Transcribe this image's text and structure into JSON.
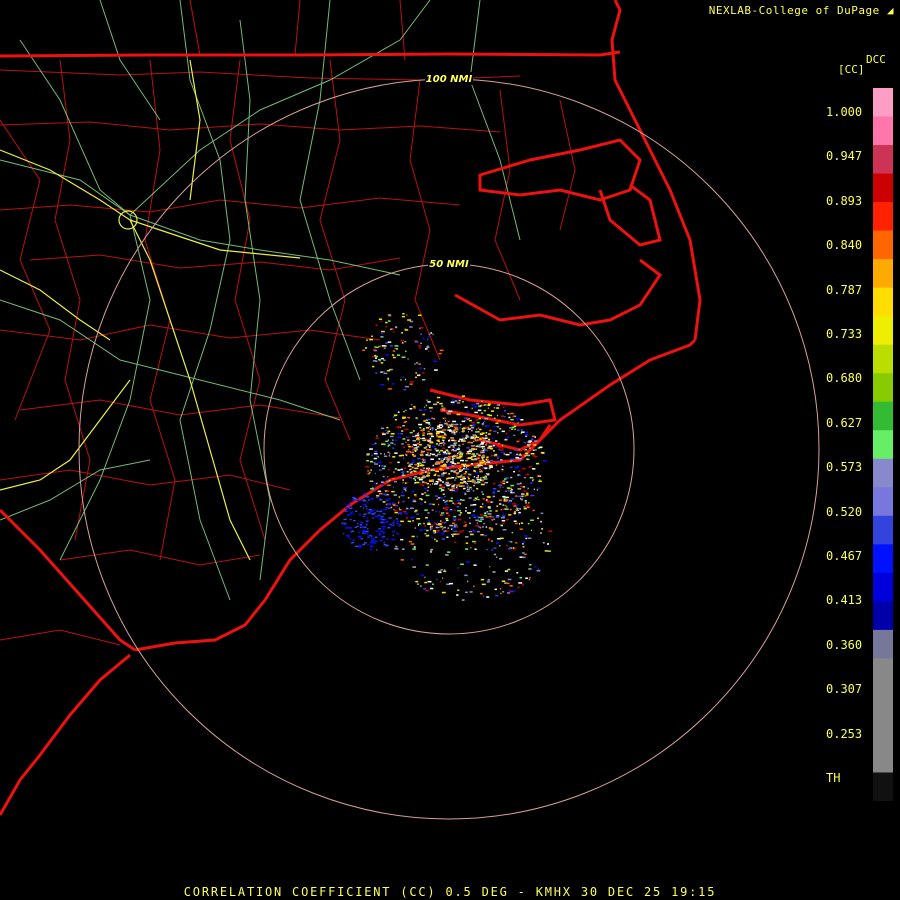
{
  "credit": "NEXLAB-College of DuPage",
  "product_code": "DCC",
  "unit": "[CC]",
  "colorbar": {
    "ticks": [
      "1.000",
      "0.947",
      "0.893",
      "0.840",
      "0.787",
      "0.733",
      "0.680",
      "0.627",
      "0.573",
      "0.520",
      "0.467",
      "0.413",
      "0.360",
      "0.307",
      "0.253",
      "TH"
    ],
    "colors": [
      "#ff9ec4",
      "#ff77aa",
      "#cc3355",
      "#cc0000",
      "#ff2200",
      "#ff6600",
      "#ffaa00",
      "#ffdd00",
      "#eeee00",
      "#bbdd00",
      "#88cc00",
      "#33bb33",
      "#66ee66",
      "#8888cc",
      "#7777dd",
      "#3344dd",
      "#0011ff",
      "#0000dd",
      "#0000aa",
      "#777799",
      "#888888",
      "#888888",
      "#888888",
      "#888888",
      "#111111"
    ]
  },
  "range_rings": [
    "100 NMI",
    "50 NMI"
  ],
  "footer": "CORRELATION COEFFICIENT (CC) 0.5 DEG - KMHX 30 DEC 25 19:15",
  "echo_colors": [
    "#0011ff",
    "#3344dd",
    "#8888cc",
    "#ffffff",
    "#ffdd00",
    "#ff6600",
    "#66ee66",
    "#eeee00",
    "#cc0000",
    "#aaaaaa"
  ]
}
